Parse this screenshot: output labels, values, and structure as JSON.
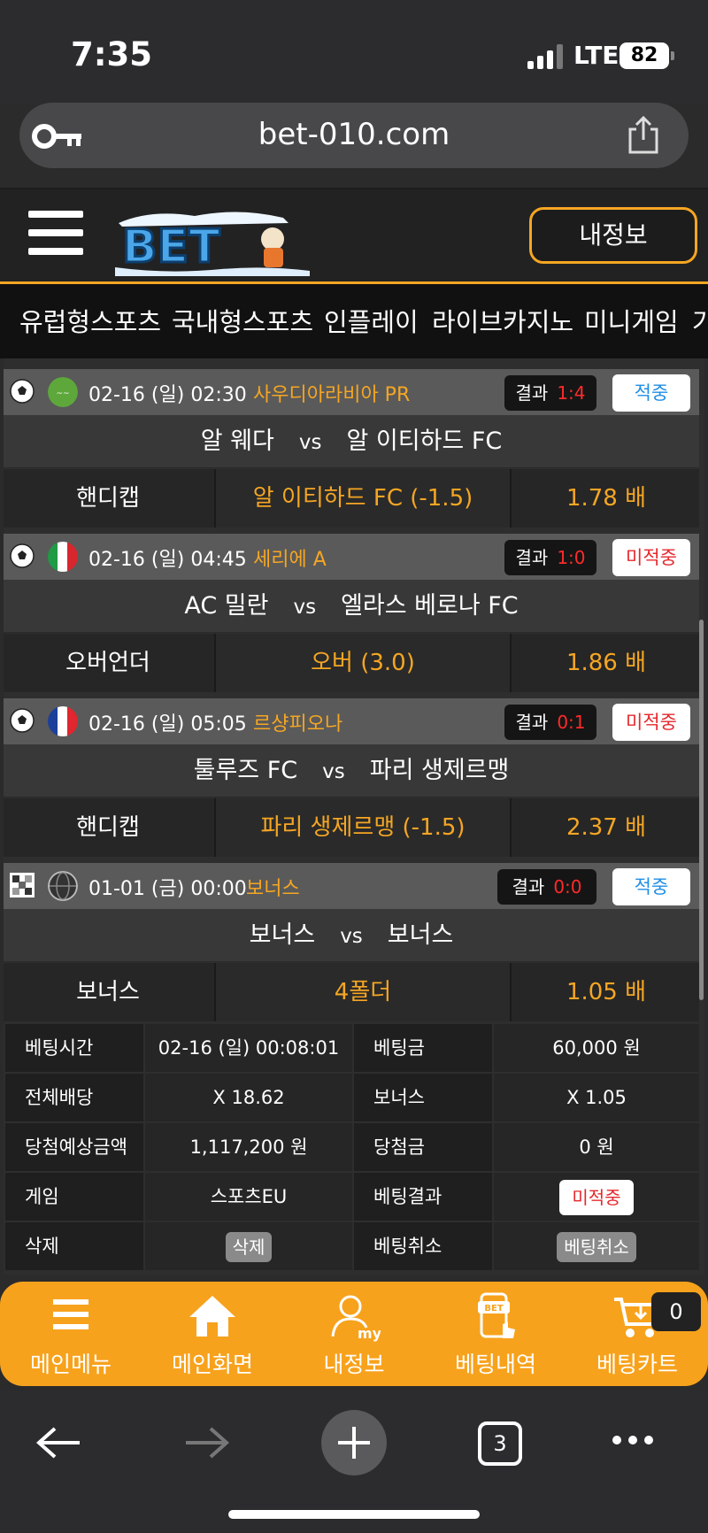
{
  "status_bar": {
    "time": "7:35",
    "network": "LTE",
    "battery": "82"
  },
  "browser": {
    "url": "bet-010.com",
    "tab_count": "3"
  },
  "header": {
    "logo_text": "BET",
    "my_info_button": "내정보"
  },
  "categories": [
    "유럽형스포츠",
    "국내형스포츠",
    "인플레이",
    "라이브카지노",
    "미니게임",
    "가"
  ],
  "matches": [
    {
      "datetime": "02-16 (일) 02:30",
      "league": "사우디아라비아 PR",
      "flag": "saudi-arabia",
      "result_label": "결과",
      "score": "1:4",
      "status": "적중",
      "status_type": "hit",
      "home": "알 웨다",
      "vs": "vs",
      "away": "알 이티하드 FC",
      "bet_type": "핸디캡",
      "pick": "알 이티하드 FC (-1.5)",
      "odds": "1.78 배"
    },
    {
      "datetime": "02-16 (일) 04:45",
      "league": "세리에 A",
      "flag": "italy",
      "result_label": "결과",
      "score": "1:0",
      "status": "미적중",
      "status_type": "miss",
      "home": "AC 밀란",
      "vs": "vs",
      "away": "엘라스 베로나 FC",
      "bet_type": "오버언더",
      "pick": "오버 (3.0)",
      "odds": "1.86 배"
    },
    {
      "datetime": "02-16 (일) 05:05",
      "league": "르샹피오나",
      "flag": "france",
      "result_label": "결과",
      "score": "0:1",
      "status": "미적중",
      "status_type": "miss",
      "home": "툴루즈 FC",
      "vs": "vs",
      "away": "파리 생제르맹",
      "bet_type": "핸디캡",
      "pick": "파리 생제르맹 (-1.5)",
      "odds": "2.37 배"
    },
    {
      "datetime": "01-01 (금) 00:00",
      "league": "보너스",
      "flag": "world",
      "result_label": "결과",
      "score": "0:0",
      "status": "적중",
      "status_type": "hit",
      "home": "보너스",
      "vs": "vs",
      "away": "보너스",
      "bet_type": "보너스",
      "pick": "4폴더",
      "odds": "1.05 배"
    }
  ],
  "summary": {
    "bet_time_label": "베팅시간",
    "bet_time": "02-16 (일) 00:08:01",
    "bet_amount_label": "베팅금",
    "bet_amount": "60,000 원",
    "total_odds_label": "전체배당",
    "total_odds": "X 18.62",
    "bonus_label": "보너스",
    "bonus": "X 1.05",
    "expected_win_label": "당첨예상금액",
    "expected_win": "1,117,200 원",
    "win_amount_label": "당첨금",
    "win_amount": "0 원",
    "game_label": "게임",
    "game": "스포츠EU",
    "bet_result_label": "베팅결과",
    "bet_result": "미적중",
    "delete_label": "삭제",
    "delete_button": "삭제",
    "cancel_label": "베팅취소",
    "cancel_button": "베팅취소"
  },
  "bottom_nav": {
    "items": [
      "메인메뉴",
      "메인화면",
      "내정보",
      "베팅내역",
      "베팅카트"
    ],
    "cart_count": "0"
  },
  "colors": {
    "accent": "#f7a21c",
    "hit": "#1f8ee6",
    "miss": "#e5282d",
    "score": "#ff2a2a"
  }
}
